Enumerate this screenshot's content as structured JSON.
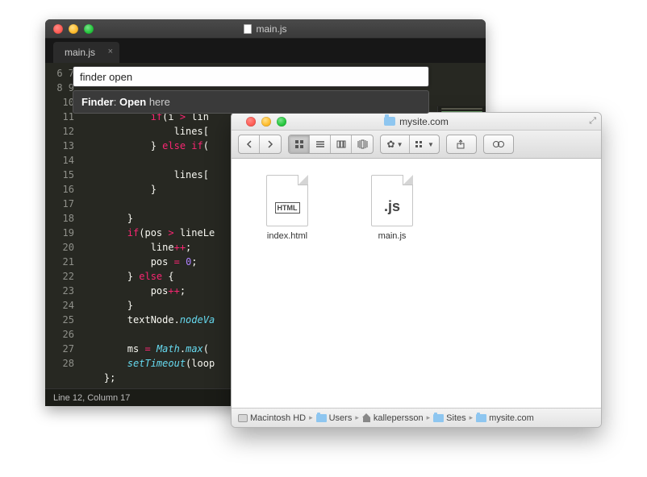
{
  "editor": {
    "window_title": "main.js",
    "tab_title": "main.js",
    "status": "Line 12, Column 17",
    "palette": {
      "input_value": "finder open",
      "suggestion_prefix": "Finder",
      "suggestion_bold": "Open",
      "suggestion_rest": "here"
    },
    "lines": {
      "start": 6,
      "end": 28
    }
  },
  "finder": {
    "title": "mysite.com",
    "files": [
      {
        "name": "index.html",
        "kind": "html",
        "glyph": "HTML"
      },
      {
        "name": "main.js",
        "kind": "js",
        "glyph": ".js"
      }
    ],
    "path": [
      {
        "icon": "hd",
        "label": "Macintosh HD"
      },
      {
        "icon": "folder",
        "label": "Users"
      },
      {
        "icon": "home",
        "label": "kallepersson"
      },
      {
        "icon": "folder",
        "label": "Sites"
      },
      {
        "icon": "folder",
        "label": "mysite.com"
      }
    ]
  }
}
